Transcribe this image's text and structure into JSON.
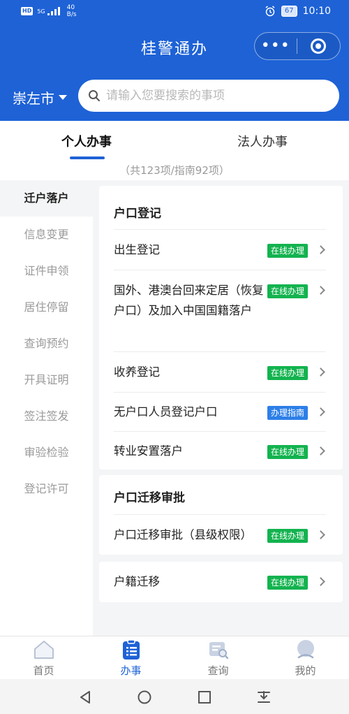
{
  "status_bar": {
    "hd": "HD",
    "net_top": "5G",
    "net_speed_value": "40",
    "net_speed_unit": "B/s",
    "battery": "67",
    "time": "10:10"
  },
  "header": {
    "title": "桂警通办",
    "more_glyph": "•••",
    "city": "崇左市",
    "search_placeholder": "请输入您要搜索的事项"
  },
  "tabs": {
    "personal": "个人办事",
    "legal": "法人办事",
    "count": "（共123项/指南92项）"
  },
  "sidebar": {
    "items": [
      {
        "label": "迁户落户"
      },
      {
        "label": "信息变更"
      },
      {
        "label": "证件申领"
      },
      {
        "label": "居住停留"
      },
      {
        "label": "查询预约"
      },
      {
        "label": "开具证明"
      },
      {
        "label": "签注签发"
      },
      {
        "label": "审验检验"
      },
      {
        "label": "登记许可"
      }
    ]
  },
  "cards": [
    {
      "title": "户口登记",
      "rows": [
        {
          "text": "出生登记",
          "badge": "在线办理"
        },
        {
          "text": "国外、港澳台回来定居（恢复户口）及加入中国国籍落户",
          "badge": "在线办理"
        },
        {
          "text": "收养登记",
          "badge": "在线办理"
        },
        {
          "text": "无户口人员登记户口",
          "badge": "办理指南"
        },
        {
          "text": "转业安置落户",
          "badge": "在线办理"
        }
      ]
    },
    {
      "title": "户口迁移审批",
      "rows": [
        {
          "text": "户口迁移审批（县级权限）",
          "badge": "在线办理"
        }
      ]
    },
    {
      "title": "",
      "rows": [
        {
          "text": "户籍迁移",
          "badge": "在线办理"
        }
      ]
    }
  ],
  "bottom_nav": {
    "items": [
      {
        "label": "首页",
        "icon": "home-icon"
      },
      {
        "label": "办事",
        "icon": "clipboard-icon"
      },
      {
        "label": "查询",
        "icon": "search-doc-icon"
      },
      {
        "label": "我的",
        "icon": "user-icon"
      }
    ]
  },
  "colors": {
    "primary": "#1e62d6",
    "online_badge": "#13b34f",
    "guide_badge": "#2d7fe8"
  }
}
